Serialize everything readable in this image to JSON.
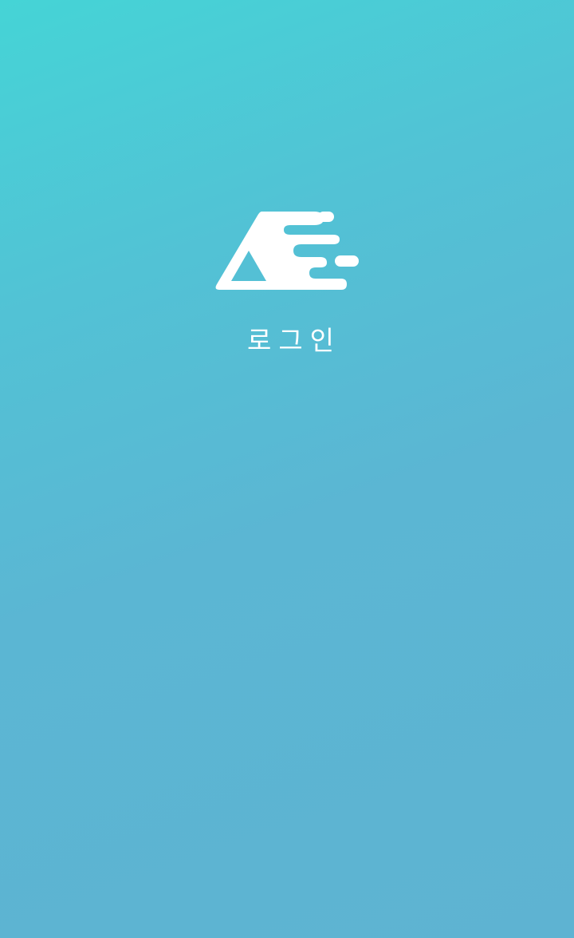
{
  "screen": {
    "background_gradient_start": "#45d4d6",
    "background_gradient_end": "#5eb3d2"
  },
  "logo": {
    "icon": "app-logo-icon",
    "color": "#ffffff"
  },
  "login": {
    "label": "로그인"
  }
}
